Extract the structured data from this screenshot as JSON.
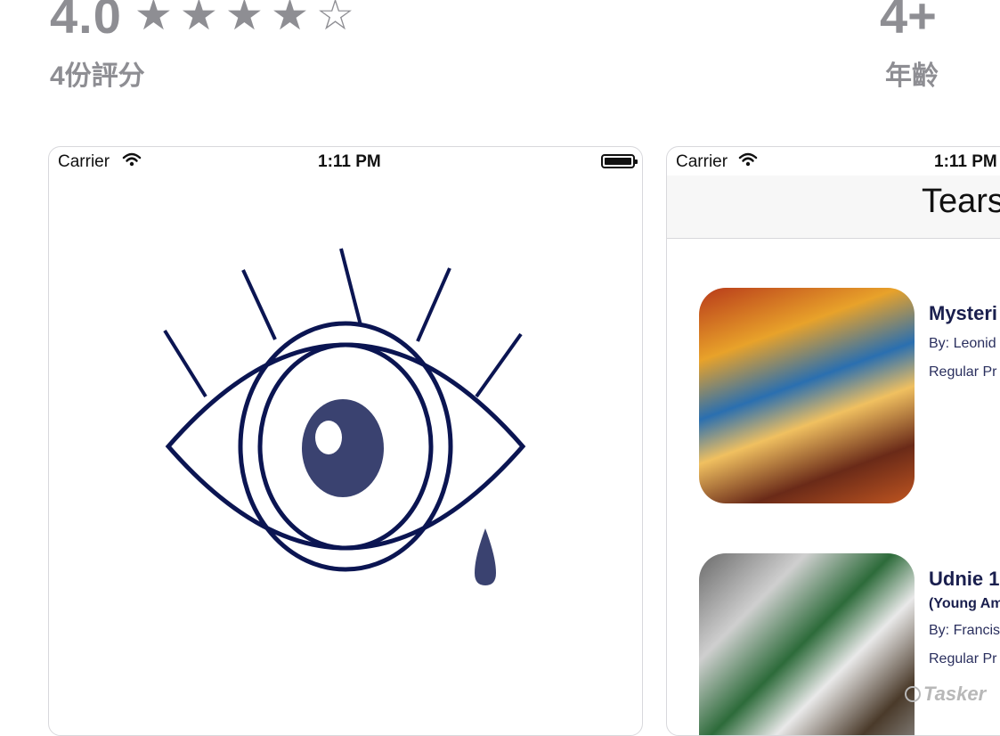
{
  "rating": {
    "value": "4.0",
    "stars_filled": 4,
    "stars_total": 5,
    "count_label": "4份評分"
  },
  "age": {
    "value": "4+",
    "label": "年齡"
  },
  "screenshot1": {
    "status": {
      "carrier": "Carrier",
      "time": "1:11 PM"
    },
    "logo": "eye-with-tear-icon"
  },
  "screenshot2": {
    "status": {
      "carrier": "Carrier",
      "time": "1:11 PM"
    },
    "nav_title": "Tears",
    "items": [
      {
        "title": "Mysteri",
        "subtitle": "",
        "by": "By: Leonid",
        "price": "Regular Pr"
      },
      {
        "title": "Udnie 1",
        "subtitle": "(Young Am",
        "by": "By: Francis",
        "price": "Regular Pr"
      }
    ]
  },
  "watermark": "Tasker",
  "colors": {
    "gray": "#8e8e93",
    "navy": "#0b1552",
    "iris": "#3a4270"
  }
}
